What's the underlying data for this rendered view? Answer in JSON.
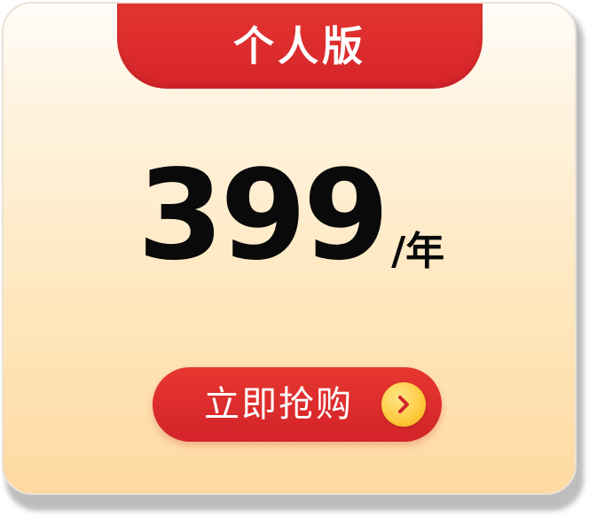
{
  "plan": {
    "name": "个人版",
    "price": "399",
    "unit": "/年"
  },
  "cta": {
    "label": "立即抢购",
    "icon": "chevron-right-icon"
  },
  "colors": {
    "accent_red": "#d9272c",
    "card_top": "#fffdf9",
    "card_bottom": "#ffd9a1",
    "arrow_gold": "#ffc93c",
    "text_dark": "#0a0a0a"
  }
}
